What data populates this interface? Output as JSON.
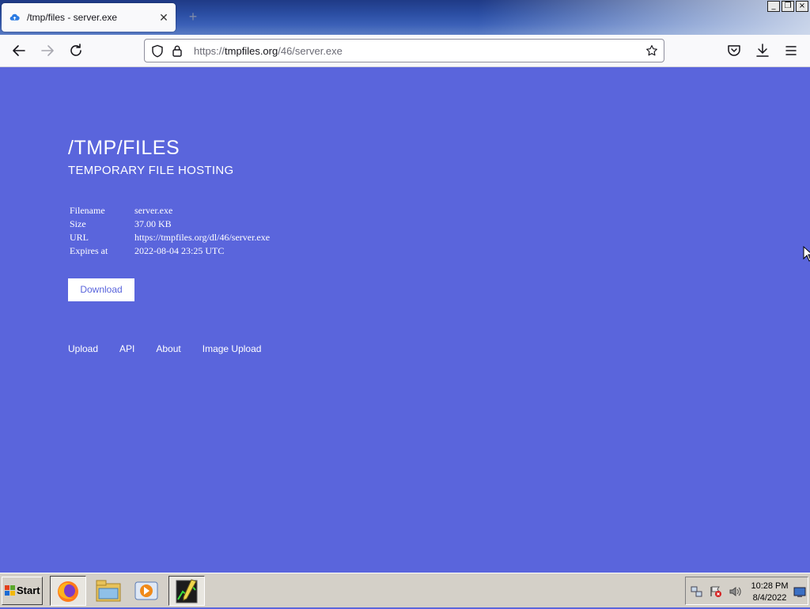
{
  "browser": {
    "tab": {
      "title": "/tmp/files - server.exe",
      "favicon": "cloud-upload-icon"
    },
    "new_tab_label": "+",
    "window_buttons": {
      "minimize": "_",
      "restore": "❐",
      "close": "×"
    },
    "url": {
      "host_prefix": "https://",
      "host": "tmpfiles.org",
      "path": "/46/server.exe"
    }
  },
  "page": {
    "title": "/TMP/FILES",
    "subtitle": "TEMPORARY FILE HOSTING",
    "file_info": [
      {
        "label": "Filename",
        "value": "server.exe"
      },
      {
        "label": "Size",
        "value": "37.00 KB"
      },
      {
        "label": "URL",
        "value": "https://tmpfiles.org/dl/46/server.exe"
      },
      {
        "label": "Expires at",
        "value": "2022-08-04 23:25 UTC"
      }
    ],
    "download_label": "Download",
    "nav_links": [
      "Upload",
      "API",
      "About",
      "Image Upload"
    ],
    "colors": {
      "background": "#5a65dc",
      "text": "#ffffff"
    }
  },
  "taskbar": {
    "start_label": "Start",
    "apps": [
      "firefox-icon",
      "file-explorer-icon",
      "media-player-icon",
      "task-manager-icon"
    ],
    "clock": {
      "time": "10:28 PM",
      "date": "8/4/2022"
    }
  }
}
